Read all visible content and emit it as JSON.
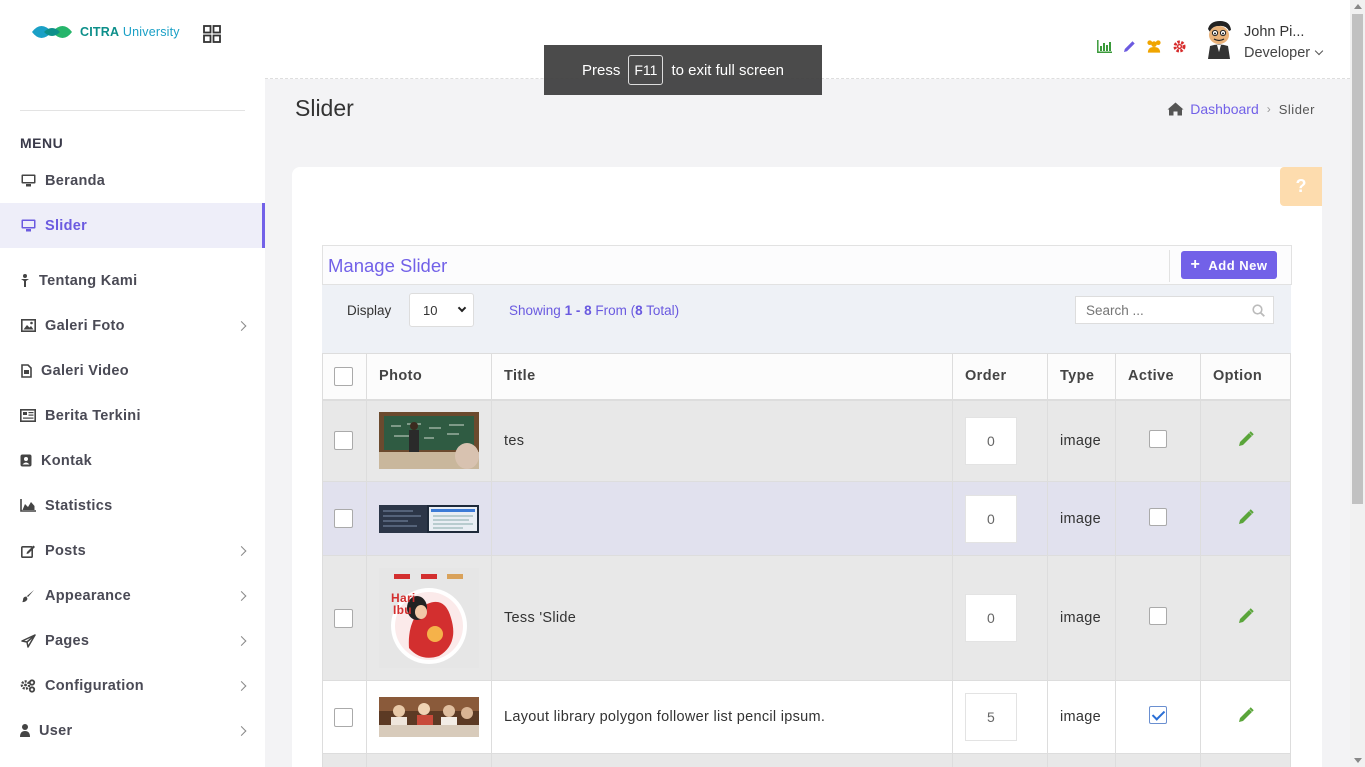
{
  "brand": {
    "name_bold": "CITRA",
    "name_light": "University"
  },
  "sidebar": {
    "menu_title": "MENU",
    "items": [
      {
        "label": "Beranda",
        "icon": "monitor-icon"
      },
      {
        "label": "Slider",
        "icon": "monitor-icon",
        "active": true
      },
      {
        "label": "Tentang Kami",
        "icon": "person-icon"
      },
      {
        "label": "Galeri Foto",
        "icon": "image-icon",
        "submenu": true
      },
      {
        "label": "Galeri Video",
        "icon": "file-icon"
      },
      {
        "label": "Berita Terkini",
        "icon": "newspaper-icon"
      },
      {
        "label": "Kontak",
        "icon": "contact-icon"
      },
      {
        "label": "Statistics",
        "icon": "area-chart-icon"
      },
      {
        "label": "Posts",
        "icon": "edit-icon",
        "submenu": true
      },
      {
        "label": "Appearance",
        "icon": "brush-icon",
        "submenu": true
      },
      {
        "label": "Pages",
        "icon": "send-icon",
        "submenu": true
      },
      {
        "label": "Configuration",
        "icon": "gears-icon",
        "submenu": true
      },
      {
        "label": "User",
        "icon": "user-icon",
        "submenu": true
      }
    ]
  },
  "header": {
    "user_name": "John Pi...",
    "user_role": "Developer",
    "icons": [
      "bar-chart-icon",
      "pencil-icon",
      "users-icon",
      "gear-icon"
    ]
  },
  "fullscreen_toast": {
    "prefix": "Press",
    "key": "F11",
    "suffix": "to exit full screen"
  },
  "page": {
    "title": "Slider",
    "breadcrumb": {
      "home": "Dashboard",
      "current": "Slider"
    }
  },
  "panel": {
    "title": "Manage Slider",
    "add_label": "Add New",
    "display_label": "Display",
    "display_value": "10",
    "showing_prefix": "Showing",
    "showing_range": "1 - 8",
    "showing_from": "From (",
    "showing_total": "8",
    "showing_suffix": "Total)",
    "search_placeholder": "Search ..."
  },
  "table": {
    "headers": {
      "photo": "Photo",
      "title": "Title",
      "order": "Order",
      "type": "Type",
      "active": "Active",
      "option": "Option"
    },
    "rows": [
      {
        "title": "tes",
        "order": "0",
        "type": "image",
        "active": false,
        "photo": "classroom"
      },
      {
        "title": "",
        "order": "0",
        "type": "image",
        "active": false,
        "photo": "screenshot"
      },
      {
        "title": "Tess 'Slide",
        "order": "0",
        "type": "image",
        "active": false,
        "photo": "poster"
      },
      {
        "title": "Layout library polygon follower list pencil ipsum.",
        "order": "5",
        "type": "image",
        "active": true,
        "photo": "dinner"
      }
    ]
  },
  "colors": {
    "accent": "#7261e8",
    "edit": "#5aa53a",
    "help": "#fddcae"
  }
}
